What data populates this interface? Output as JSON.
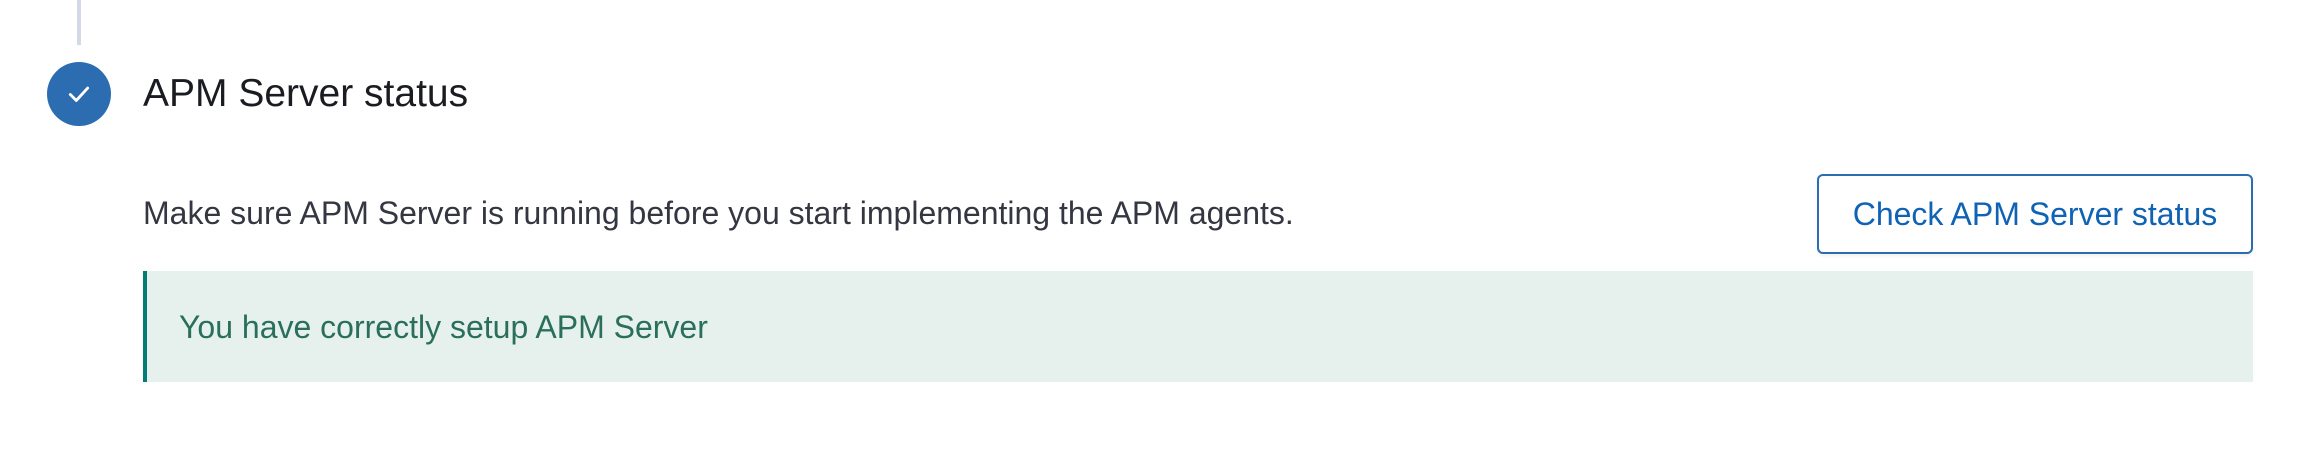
{
  "step": {
    "title": "APM Server status",
    "icon": "check-icon",
    "status_color": "#2c6cb0",
    "description": "Make sure APM Server is running before you start implementing the APM agents.",
    "check_button_label": "Check APM Server status",
    "callout": {
      "text": "You have correctly setup APM Server",
      "color": "#017d73"
    }
  }
}
